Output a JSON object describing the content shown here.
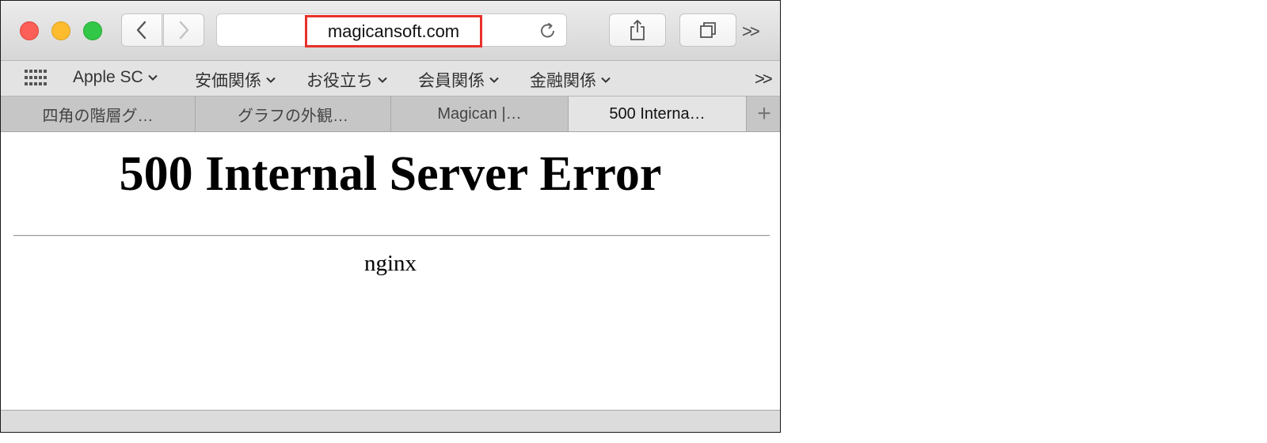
{
  "toolbar": {
    "url": "magicansoft.com",
    "overflow": ">>"
  },
  "bookmarks": {
    "items": [
      {
        "label": "Apple SC"
      },
      {
        "label": "安価関係"
      },
      {
        "label": "お役立ち"
      },
      {
        "label": "会員関係"
      },
      {
        "label": "金融関係"
      }
    ],
    "overflow": ">>"
  },
  "tabs": {
    "items": [
      {
        "label": "四角の階層グ…"
      },
      {
        "label": "グラフの外観…"
      },
      {
        "label": "Magican |…"
      },
      {
        "label": "500 Interna…"
      }
    ],
    "active_index": 3,
    "add_label": "+"
  },
  "page": {
    "heading": "500 Internal Server Error",
    "server": "nginx"
  },
  "colors": {
    "highlight_border": "#e8302a",
    "close": "#fc5f57",
    "minimize": "#fdbc2e",
    "zoom": "#33c748"
  },
  "icons": [
    "close-icon",
    "minimize-icon",
    "zoom-icon",
    "chevron-left-icon",
    "chevron-right-icon",
    "reload-icon",
    "share-icon",
    "tabs-overview-icon",
    "bookmarks-grid-icon",
    "chevron-down-icon",
    "add-tab-icon"
  ]
}
